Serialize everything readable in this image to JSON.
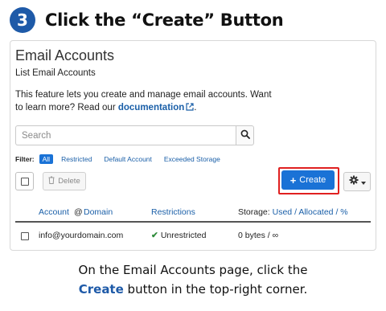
{
  "step": {
    "number": "3",
    "title": "Click the “Create” Button"
  },
  "page": {
    "title": "Email Accounts",
    "subtitle": "List Email Accounts",
    "intro_text": "This feature lets you create and manage email accounts. Want to learn more? Read our ",
    "doc_link": "documentation",
    "intro_end": "."
  },
  "search": {
    "placeholder": "Search",
    "button_icon": "search-icon"
  },
  "filter": {
    "label": "Filter:",
    "options": [
      "All",
      "Restricted",
      "Default Account",
      "Exceeded Storage"
    ],
    "active": "All"
  },
  "toolbar": {
    "delete_label": "Delete",
    "create_label": "Create",
    "create_prefix": "+",
    "gear_icon": "gear-icon",
    "highlight_color": "#e02020",
    "accent_color": "#1a72d6"
  },
  "table": {
    "headers": {
      "account": "Account",
      "at": "@",
      "domain": "Domain",
      "restrictions": "Restrictions",
      "storage_prefix": "Storage:",
      "storage_used": "Used",
      "sep1": "/",
      "storage_allocated": "Allocated",
      "sep2": "/",
      "storage_percent": "%"
    },
    "rows": [
      {
        "email": "info@yourdomain.com",
        "restriction": "Unrestricted",
        "storage": "0 bytes / ∞"
      }
    ]
  },
  "caption": {
    "line1": "On the Email Accounts page, click the",
    "highlight": "Create",
    "line2_rest": " button in the top-right corner."
  }
}
